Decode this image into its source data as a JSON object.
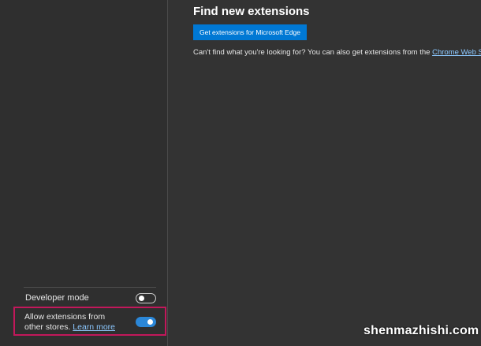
{
  "main": {
    "title": "Find new extensions",
    "get_extensions_button": "Get extensions for Microsoft Edge",
    "cant_find_text": "Can't find what you're looking for? You can also get extensions from the ",
    "chrome_store_link": "Chrome Web Store",
    "cant_find_suffix": "."
  },
  "sidebar": {
    "developer_mode": {
      "label": "Developer mode",
      "enabled": false
    },
    "allow_other_stores": {
      "label": "Allow extensions from other stores.",
      "learn_more": "Learn more",
      "enabled": true
    }
  },
  "watermark": "shenmazhishi.com",
  "colors": {
    "accent": "#0078d4",
    "toggle_on": "#2b87d8",
    "highlight": "#c2185b",
    "link": "#8cc8ff"
  }
}
